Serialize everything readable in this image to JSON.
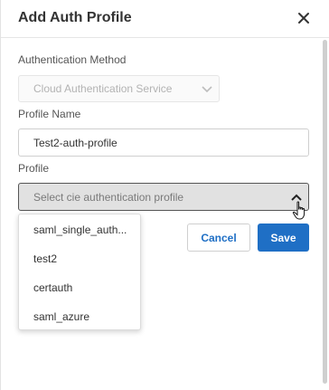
{
  "dialog": {
    "title": "Add Auth Profile",
    "close_icon": "close-icon"
  },
  "form": {
    "auth_method": {
      "label": "Authentication Method",
      "value": "Cloud Authentication Service",
      "disabled": true
    },
    "profile_name": {
      "label": "Profile Name",
      "value": "Test2-auth-profile"
    },
    "profile": {
      "label": "Profile",
      "placeholder": "Select cie authentication profile",
      "expanded": true,
      "options": [
        "saml_single_auth...",
        "test2",
        "certauth",
        "saml_azure"
      ]
    }
  },
  "actions": {
    "cancel_label": "Cancel",
    "save_label": "Save"
  },
  "colors": {
    "accent": "#1f6fc5",
    "open_select_bg": "#e1e1e1"
  }
}
